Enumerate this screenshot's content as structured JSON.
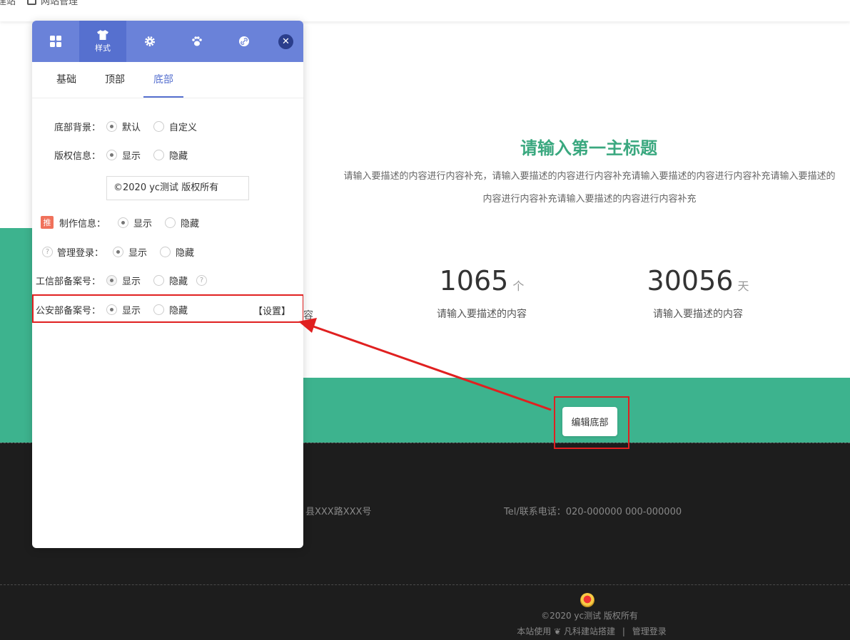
{
  "topbar": {
    "crumb_partial": "建站",
    "manage_label": "网站管理"
  },
  "page": {
    "main_title": "请输入第一主标题",
    "main_desc": "请输入要描述的内容进行内容补充，请输入要描述的内容进行内容补充请输入要描述的内容进行内容补充请输入要描述的内容进行内容补充请输入要描述的内容进行内容补充",
    "stray_fragment": "容",
    "stats": [
      {
        "value": "1065",
        "unit": "个",
        "label": "请输入要描述的内容"
      },
      {
        "value": "30056",
        "unit": "天",
        "label": "请输入要描述的内容"
      }
    ],
    "edit_footer_label": "编辑底部",
    "footer": {
      "address_partial": "县XXX路XXX号",
      "tel": "Tel/联系电话：020-000000 000-000000",
      "copyright": "©2020 yc测试 版权所有",
      "powered_prefix": "本站使用",
      "powered_brand": "凡科建站搭建",
      "admin_login": "管理登录"
    }
  },
  "panel": {
    "tabs": [
      {
        "icon": "grid-icon",
        "label": ""
      },
      {
        "icon": "shirt-icon",
        "label": "样式"
      },
      {
        "icon": "gear-icon",
        "label": ""
      },
      {
        "icon": "paw-icon",
        "label": ""
      },
      {
        "icon": "link-icon",
        "label": ""
      }
    ],
    "subtabs": [
      "基础",
      "顶部",
      "底部"
    ],
    "active_subtab": "底部",
    "rows": {
      "footer_bg": {
        "label": "底部背景：",
        "opt1": "默认",
        "opt2": "自定义"
      },
      "copyright": {
        "label": "版权信息：",
        "opt1": "显示",
        "opt2": "隐藏",
        "value": "©2020 yc测试 版权所有"
      },
      "credits": {
        "badge": "推",
        "label": "制作信息：",
        "opt1": "显示",
        "opt2": "隐藏"
      },
      "admin": {
        "help": "?",
        "label": "管理登录：",
        "opt1": "显示",
        "opt2": "隐藏"
      },
      "icp": {
        "label": "工信部备案号：",
        "opt1": "显示",
        "opt2": "隐藏",
        "help": "?"
      },
      "police": {
        "label": "公安部备案号：",
        "opt1": "显示",
        "opt2": "隐藏",
        "set_link": "【设置】"
      }
    }
  },
  "annotations": {
    "color": "#e02020"
  }
}
